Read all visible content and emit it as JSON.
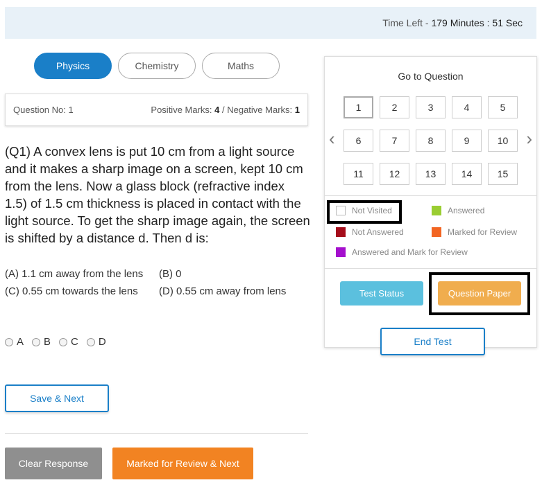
{
  "timer": {
    "label": "Time Left - ",
    "value": "179 Minutes : 51 Sec"
  },
  "subjects": [
    {
      "label": "Physics",
      "active": true
    },
    {
      "label": "Chemistry",
      "active": false
    },
    {
      "label": "Maths",
      "active": false
    }
  ],
  "question_info": {
    "number_label": "Question No: 1",
    "positive_label": "Positive Marks: ",
    "positive_value": "4",
    "negative_label": " / Negative Marks: ",
    "negative_value": "1"
  },
  "question": {
    "text": "(Q1) A convex lens is put 10 cm from a light source and it makes a sharp image on a screen, kept 10 cm from the lens. Now a glass block (refractive index 1.5) of 1.5 cm thickness is placed in contact with the light source. To get the sharp image again, the screen is shifted by a distance d. Then d is:",
    "options": [
      {
        "a": "(A) 1.1 cm away from the lens",
        "b": "(B) 0"
      },
      {
        "a": "(C) 0.55 cm towards the lens",
        "b": "(D) 0.55 cm away from lens"
      }
    ],
    "choices": [
      "A",
      "B",
      "C",
      "D"
    ]
  },
  "actions": {
    "save_next": "Save & Next",
    "clear_response": "Clear Response",
    "marked_review_next": "Marked for Review & Next"
  },
  "panel": {
    "title": "Go to Question",
    "questions": [
      "1",
      "2",
      "3",
      "4",
      "5",
      "6",
      "7",
      "8",
      "9",
      "10",
      "11",
      "12",
      "13",
      "14",
      "15"
    ],
    "current": "1",
    "prev_icon": "‹",
    "next_icon": "›",
    "legend": {
      "not_visited": "Not Visited",
      "answered": "Answered",
      "not_answered": "Not Answered",
      "marked_review": "Marked for Review",
      "answered_marked": "Answered and Mark for Review"
    },
    "legend_colors": {
      "not_visited": "#ffffff",
      "answered": "#9acd32",
      "not_answered": "#a50d1b",
      "marked_review": "#f26522",
      "answered_marked": "#a40fcd"
    },
    "test_status": "Test Status",
    "question_paper": "Question Paper",
    "end_test": "End Test"
  }
}
